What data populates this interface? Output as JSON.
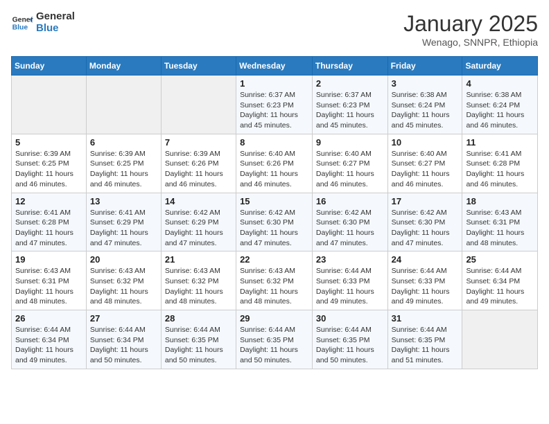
{
  "header": {
    "logo_line1": "General",
    "logo_line2": "Blue",
    "month": "January 2025",
    "location": "Wenago, SNNPR, Ethiopia"
  },
  "days_of_week": [
    "Sunday",
    "Monday",
    "Tuesday",
    "Wednesday",
    "Thursday",
    "Friday",
    "Saturday"
  ],
  "weeks": [
    [
      {
        "day": "",
        "info": ""
      },
      {
        "day": "",
        "info": ""
      },
      {
        "day": "",
        "info": ""
      },
      {
        "day": "1",
        "info": "Sunrise: 6:37 AM\nSunset: 6:23 PM\nDaylight: 11 hours and 45 minutes."
      },
      {
        "day": "2",
        "info": "Sunrise: 6:37 AM\nSunset: 6:23 PM\nDaylight: 11 hours and 45 minutes."
      },
      {
        "day": "3",
        "info": "Sunrise: 6:38 AM\nSunset: 6:24 PM\nDaylight: 11 hours and 45 minutes."
      },
      {
        "day": "4",
        "info": "Sunrise: 6:38 AM\nSunset: 6:24 PM\nDaylight: 11 hours and 46 minutes."
      }
    ],
    [
      {
        "day": "5",
        "info": "Sunrise: 6:39 AM\nSunset: 6:25 PM\nDaylight: 11 hours and 46 minutes."
      },
      {
        "day": "6",
        "info": "Sunrise: 6:39 AM\nSunset: 6:25 PM\nDaylight: 11 hours and 46 minutes."
      },
      {
        "day": "7",
        "info": "Sunrise: 6:39 AM\nSunset: 6:26 PM\nDaylight: 11 hours and 46 minutes."
      },
      {
        "day": "8",
        "info": "Sunrise: 6:40 AM\nSunset: 6:26 PM\nDaylight: 11 hours and 46 minutes."
      },
      {
        "day": "9",
        "info": "Sunrise: 6:40 AM\nSunset: 6:27 PM\nDaylight: 11 hours and 46 minutes."
      },
      {
        "day": "10",
        "info": "Sunrise: 6:40 AM\nSunset: 6:27 PM\nDaylight: 11 hours and 46 minutes."
      },
      {
        "day": "11",
        "info": "Sunrise: 6:41 AM\nSunset: 6:28 PM\nDaylight: 11 hours and 46 minutes."
      }
    ],
    [
      {
        "day": "12",
        "info": "Sunrise: 6:41 AM\nSunset: 6:28 PM\nDaylight: 11 hours and 47 minutes."
      },
      {
        "day": "13",
        "info": "Sunrise: 6:41 AM\nSunset: 6:29 PM\nDaylight: 11 hours and 47 minutes."
      },
      {
        "day": "14",
        "info": "Sunrise: 6:42 AM\nSunset: 6:29 PM\nDaylight: 11 hours and 47 minutes."
      },
      {
        "day": "15",
        "info": "Sunrise: 6:42 AM\nSunset: 6:30 PM\nDaylight: 11 hours and 47 minutes."
      },
      {
        "day": "16",
        "info": "Sunrise: 6:42 AM\nSunset: 6:30 PM\nDaylight: 11 hours and 47 minutes."
      },
      {
        "day": "17",
        "info": "Sunrise: 6:42 AM\nSunset: 6:30 PM\nDaylight: 11 hours and 47 minutes."
      },
      {
        "day": "18",
        "info": "Sunrise: 6:43 AM\nSunset: 6:31 PM\nDaylight: 11 hours and 48 minutes."
      }
    ],
    [
      {
        "day": "19",
        "info": "Sunrise: 6:43 AM\nSunset: 6:31 PM\nDaylight: 11 hours and 48 minutes."
      },
      {
        "day": "20",
        "info": "Sunrise: 6:43 AM\nSunset: 6:32 PM\nDaylight: 11 hours and 48 minutes."
      },
      {
        "day": "21",
        "info": "Sunrise: 6:43 AM\nSunset: 6:32 PM\nDaylight: 11 hours and 48 minutes."
      },
      {
        "day": "22",
        "info": "Sunrise: 6:43 AM\nSunset: 6:32 PM\nDaylight: 11 hours and 48 minutes."
      },
      {
        "day": "23",
        "info": "Sunrise: 6:44 AM\nSunset: 6:33 PM\nDaylight: 11 hours and 49 minutes."
      },
      {
        "day": "24",
        "info": "Sunrise: 6:44 AM\nSunset: 6:33 PM\nDaylight: 11 hours and 49 minutes."
      },
      {
        "day": "25",
        "info": "Sunrise: 6:44 AM\nSunset: 6:34 PM\nDaylight: 11 hours and 49 minutes."
      }
    ],
    [
      {
        "day": "26",
        "info": "Sunrise: 6:44 AM\nSunset: 6:34 PM\nDaylight: 11 hours and 49 minutes."
      },
      {
        "day": "27",
        "info": "Sunrise: 6:44 AM\nSunset: 6:34 PM\nDaylight: 11 hours and 50 minutes."
      },
      {
        "day": "28",
        "info": "Sunrise: 6:44 AM\nSunset: 6:35 PM\nDaylight: 11 hours and 50 minutes."
      },
      {
        "day": "29",
        "info": "Sunrise: 6:44 AM\nSunset: 6:35 PM\nDaylight: 11 hours and 50 minutes."
      },
      {
        "day": "30",
        "info": "Sunrise: 6:44 AM\nSunset: 6:35 PM\nDaylight: 11 hours and 50 minutes."
      },
      {
        "day": "31",
        "info": "Sunrise: 6:44 AM\nSunset: 6:35 PM\nDaylight: 11 hours and 51 minutes."
      },
      {
        "day": "",
        "info": ""
      }
    ]
  ]
}
